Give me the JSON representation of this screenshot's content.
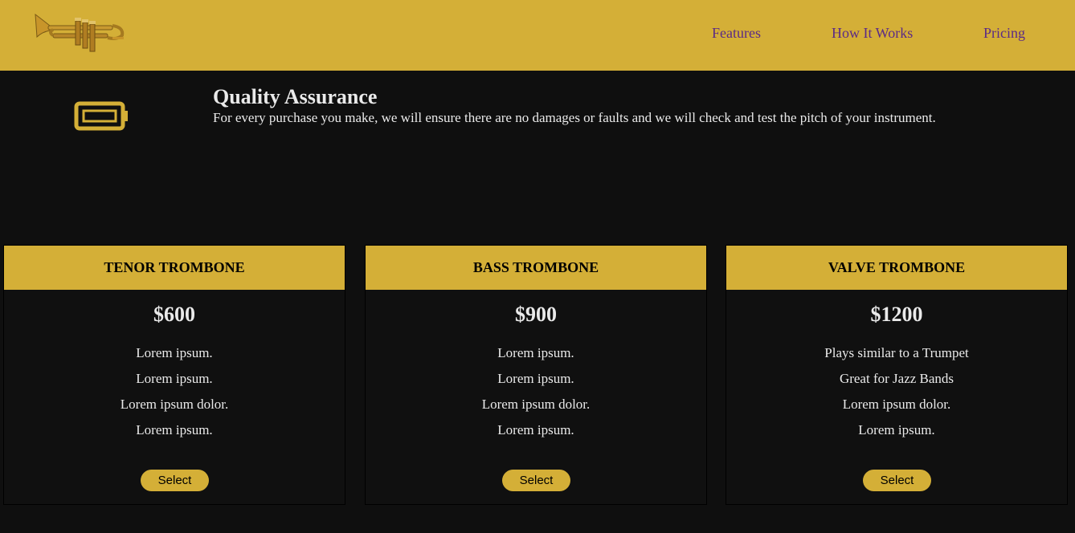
{
  "nav": {
    "logo_icon": "trumpet-logo",
    "links": [
      "Features",
      "How It Works",
      "Pricing"
    ]
  },
  "feature": {
    "icon": "battery-icon",
    "title": "Quality Assurance",
    "description": "For every purchase you make, we will ensure there are no damages or faults and we will check and test the pitch of your instrument."
  },
  "pricing": {
    "cards": [
      {
        "name": "TENOR TROMBONE",
        "price": "$600",
        "features": [
          "Lorem ipsum.",
          "Lorem ipsum.",
          "Lorem ipsum dolor.",
          "Lorem ipsum."
        ],
        "button": "Select"
      },
      {
        "name": "BASS TROMBONE",
        "price": "$900",
        "features": [
          "Lorem ipsum.",
          "Lorem ipsum.",
          "Lorem ipsum dolor.",
          "Lorem ipsum."
        ],
        "button": "Select"
      },
      {
        "name": "VALVE TROMBONE",
        "price": "$1200",
        "features": [
          "Plays similar to a Trumpet",
          "Great for Jazz Bands",
          "Lorem ipsum dolor.",
          "Lorem ipsum."
        ],
        "button": "Select"
      }
    ]
  },
  "colors": {
    "accent": "#d4af37",
    "background": "#0f0f0f",
    "nav_link": "#5b2a86",
    "text": "#eaeaea"
  }
}
